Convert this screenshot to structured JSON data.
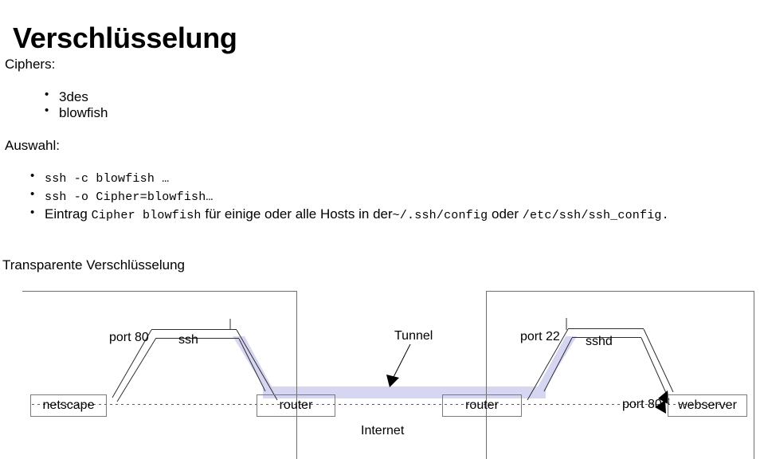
{
  "slide": {
    "title": "Verschlüsselung",
    "lead_ciphers": "Ciphers:",
    "lead_auswahl": "Auswahl:",
    "lead_transparent": "Transparente Verschlüsselung",
    "cipher_items": [
      "3des",
      "blowfish"
    ],
    "auswahl_items": [
      {
        "parts": [
          {
            "style": "mono",
            "text": "ssh -c blowfish …"
          }
        ]
      },
      {
        "parts": [
          {
            "style": "mono",
            "text": "ssh -o Cipher=blowfish…"
          }
        ]
      },
      {
        "parts": [
          {
            "style": "sans",
            "text": "Eintrag "
          },
          {
            "style": "mono",
            "text": "Cipher blowfish"
          },
          {
            "style": "sans",
            "text": " für einige oder alle Hosts in der"
          },
          {
            "style": "mono",
            "text": "~/.ssh/config"
          },
          {
            "style": "sans",
            "text": " oder "
          },
          {
            "style": "mono",
            "text": "/etc/ssh/ssh_config."
          }
        ]
      }
    ]
  },
  "diagram": {
    "colors": {
      "tunnel_band": "#d6d6f2",
      "box_border": "#7a7a7a",
      "line": "#3a3a3a",
      "frame": "#6e6e6e"
    },
    "nodes": [
      {
        "id": "netscape",
        "label": "netscape"
      },
      {
        "id": "router-left",
        "label": "router"
      },
      {
        "id": "router-right",
        "label": "router"
      },
      {
        "id": "webserver",
        "label": "webserver"
      }
    ],
    "labels": [
      {
        "id": "port-80-client",
        "text": "port 80"
      },
      {
        "id": "ssh",
        "text": "ssh"
      },
      {
        "id": "tunnel",
        "text": "Tunnel"
      },
      {
        "id": "port-22",
        "text": "port 22"
      },
      {
        "id": "sshd",
        "text": "sshd"
      },
      {
        "id": "port-80-server",
        "text": "port 80"
      },
      {
        "id": "internet",
        "text": "Internet"
      }
    ]
  }
}
